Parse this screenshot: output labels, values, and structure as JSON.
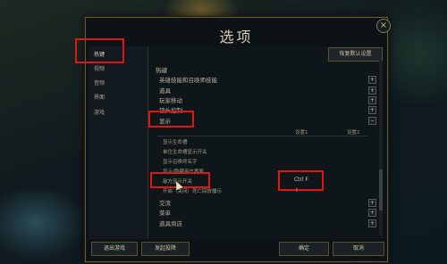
{
  "window": {
    "title": "选项",
    "close_icon": "×"
  },
  "sidebar": {
    "items": [
      {
        "label": "热键",
        "active": true
      },
      {
        "label": "视频"
      },
      {
        "label": "音频"
      },
      {
        "label": "界面"
      },
      {
        "label": "游戏"
      }
    ]
  },
  "header": {
    "restore_defaults_label": "恢复默认设置"
  },
  "hotkeys": {
    "section_label": "热键",
    "groups": [
      "英雄技能和召唤师技能",
      "道具",
      "玩家移动",
      "镜头控制"
    ],
    "display_section_label": "显示",
    "columns": {
      "setting1": "设置1",
      "setting2": "设置2"
    },
    "display_items": [
      "显示生命槽",
      "单位生命槽显示开关",
      "显示召唤师名字",
      "显示/隐藏用户界面",
      "敌方显示开关",
      "开启（关闭）死亡回放播示"
    ],
    "toggle_key": "Ctrl F",
    "after_groups": [
      "交流",
      "菜单",
      "道具商店"
    ]
  },
  "footer": {
    "exit_game_label": "退出游戏",
    "surrender_label": "发起投降",
    "ok_label": "确定",
    "cancel_label": "取消"
  },
  "colors": {
    "highlight": "#e01515",
    "gold_border": "#6b5a35"
  }
}
